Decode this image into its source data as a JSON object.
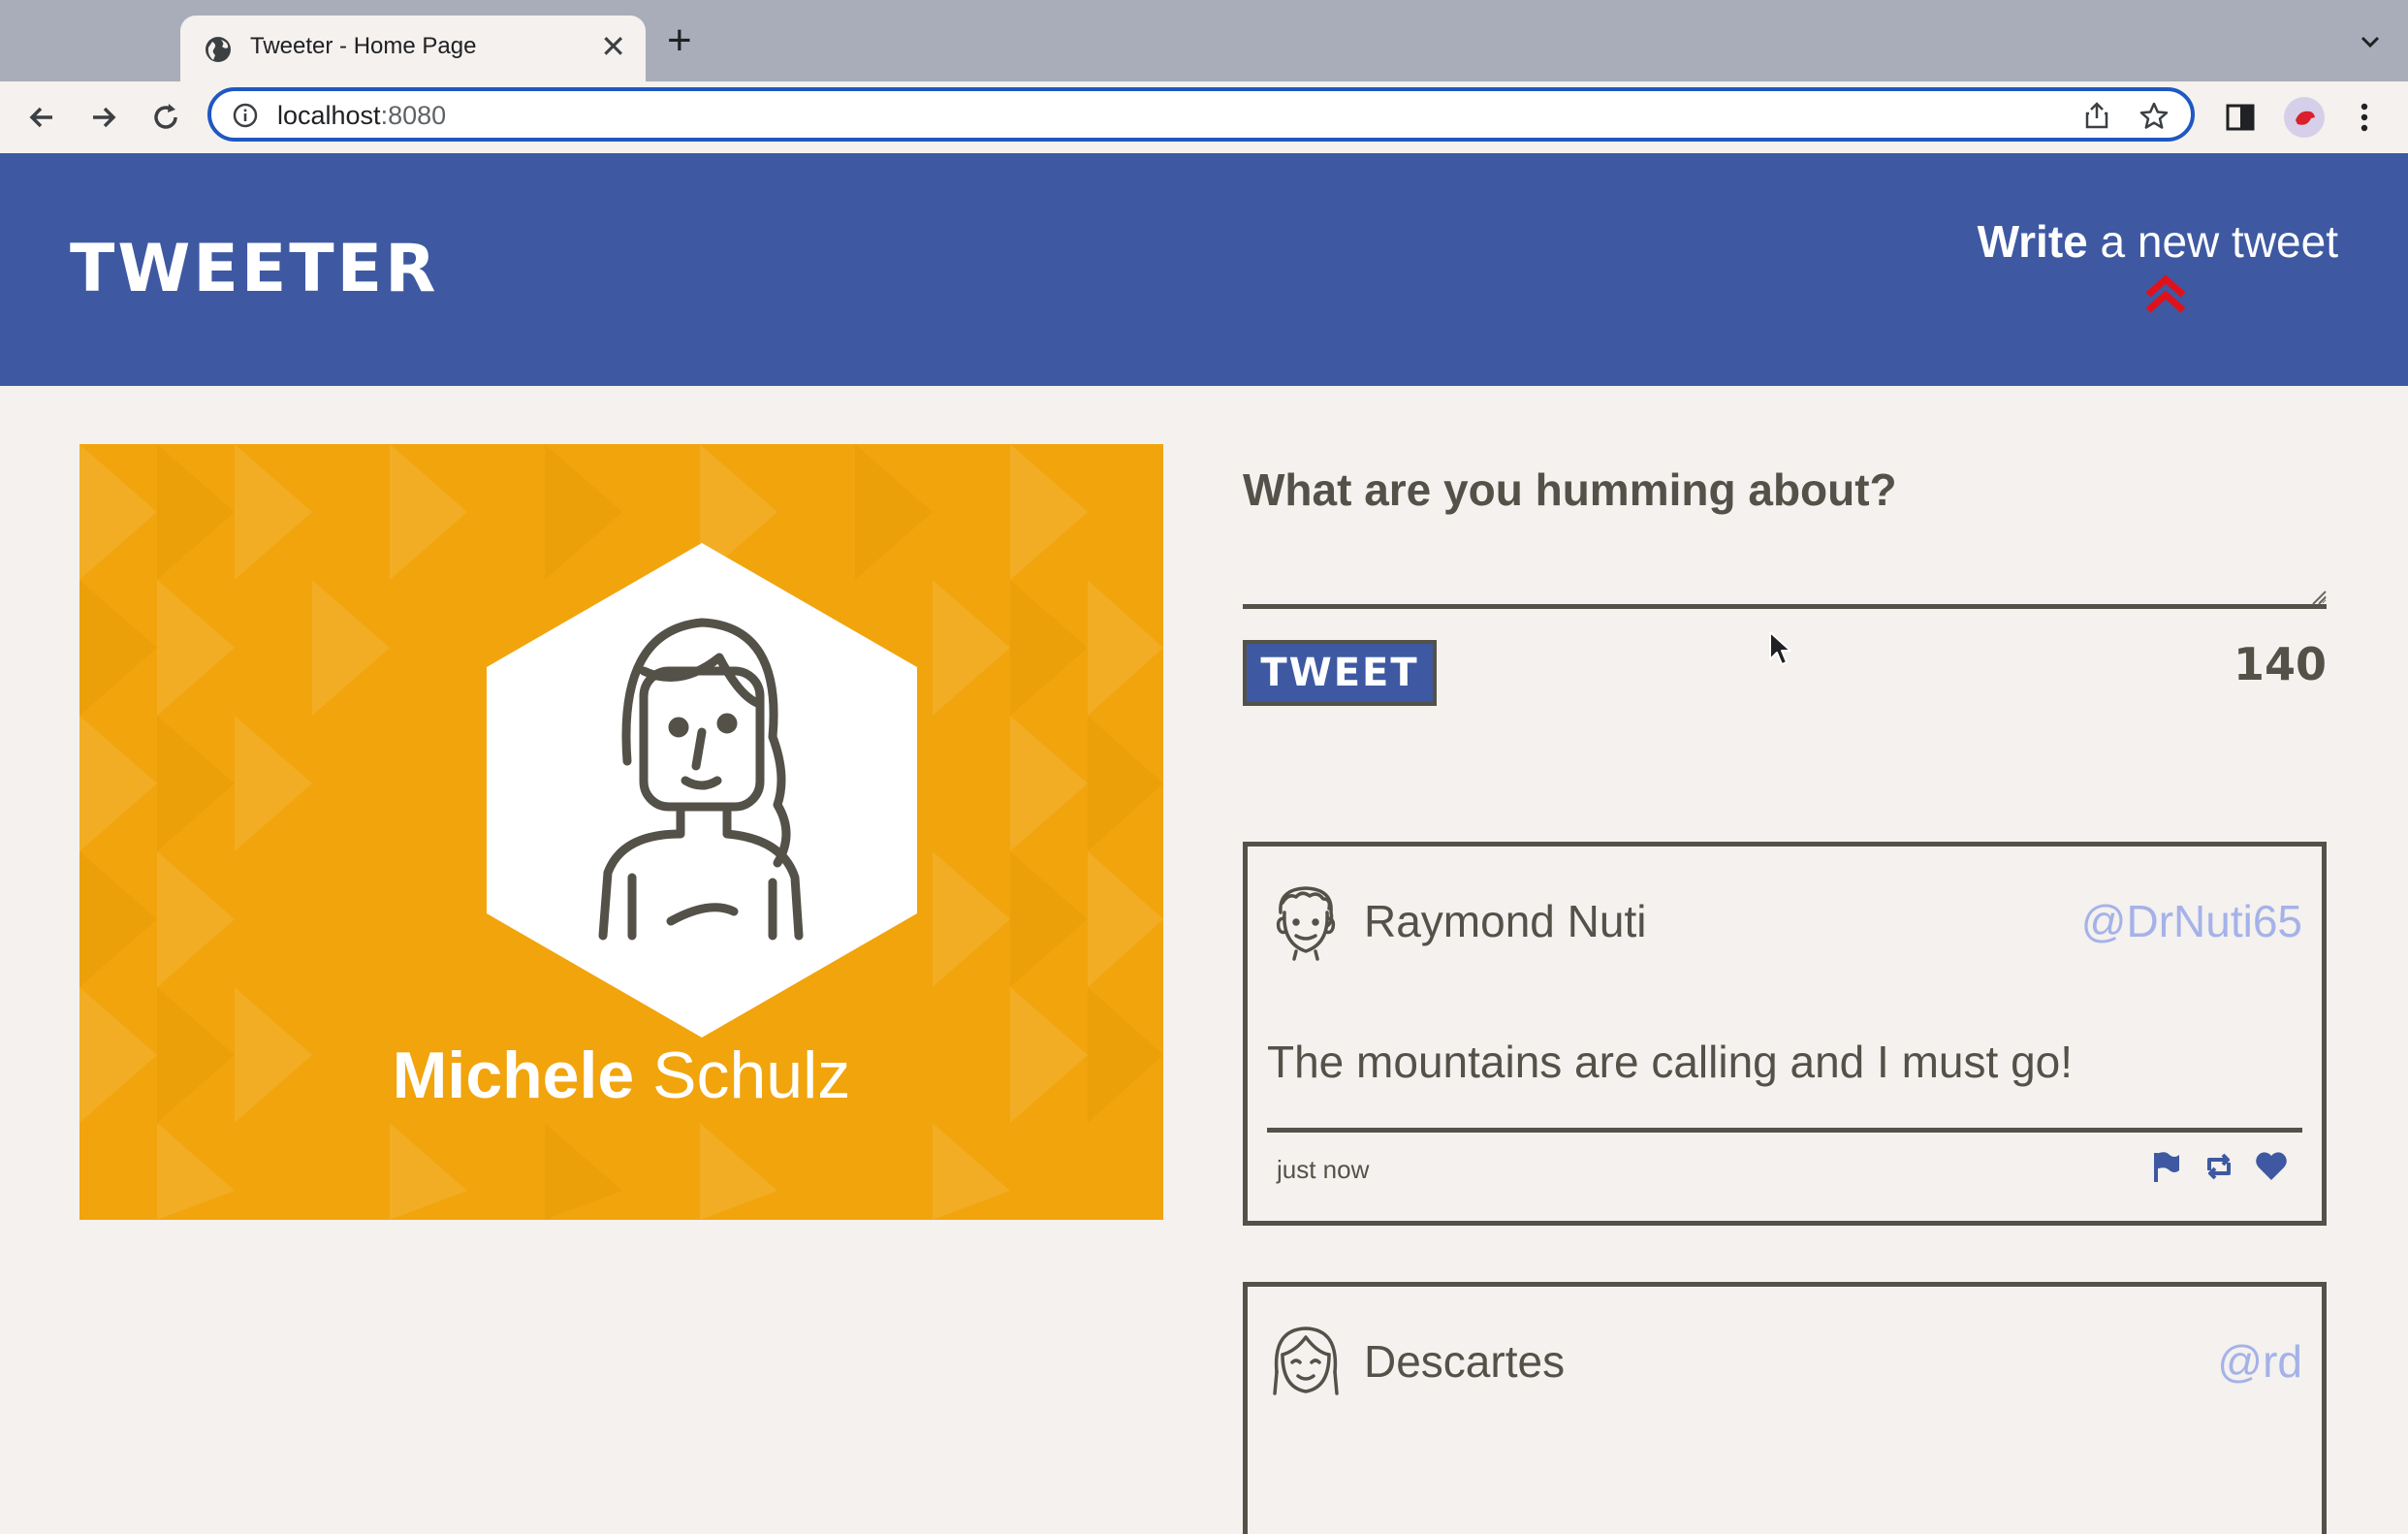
{
  "browser": {
    "tab_title": "Tweeter - Home Page",
    "url_host": "localhost",
    "url_port": ":8080"
  },
  "header": {
    "logo": "TWEETER",
    "compose_link_bold": "Write",
    "compose_link_rest": " a new tweet",
    "arrow_color": "#e0111a"
  },
  "profile": {
    "first_name": "Michele",
    "last_name": " Schulz",
    "card_color": "#f1a40c"
  },
  "compose": {
    "label": "What are you humming about?",
    "textarea_value": "",
    "button_label": "TWEET",
    "char_count": "140"
  },
  "tweets": [
    {
      "author": "Raymond Nuti",
      "handle": "@DrNuti65",
      "content": "The mountains are calling and I must go!",
      "timestamp": "just now",
      "actions": [
        "flag-icon",
        "retweet-icon",
        "heart-icon"
      ]
    },
    {
      "author": "Descartes",
      "handle": "@rd",
      "content": ""
    }
  ],
  "colors": {
    "header_bg": "#3e59a1",
    "page_bg": "#f4f1ee",
    "text": "#545149",
    "handle": "#a5b2e9"
  }
}
